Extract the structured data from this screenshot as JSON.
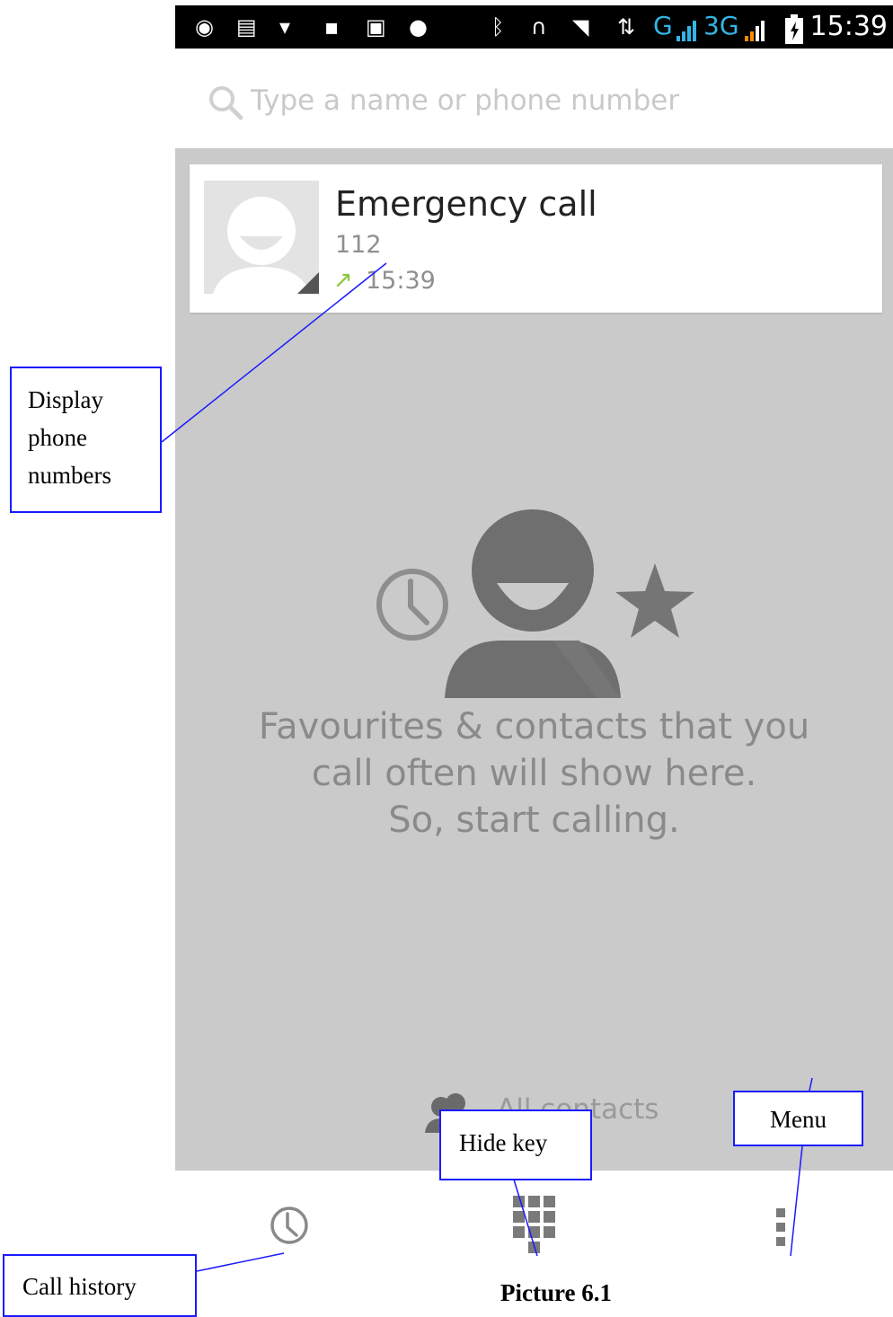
{
  "status_bar": {
    "time": "15:39",
    "network_labels": [
      "G",
      "3G"
    ],
    "icons": [
      "app-notification-icon",
      "message-icon",
      "wifi-notification-icon",
      "lock-icon",
      "image-icon",
      "hangouts-icon",
      "bluetooth-icon",
      "headphones-icon",
      "wifi-icon",
      "data-transfer-icon",
      "signal-icon",
      "signal-icon",
      "battery-icon"
    ],
    "accent_color": "#33b5e5"
  },
  "search": {
    "placeholder": "Type a name or phone number"
  },
  "recent_call": {
    "name": "Emergency call",
    "number": "112",
    "time": "15:39",
    "direction_glyph": "↗",
    "direction_color": "#8cc63f"
  },
  "empty_state": {
    "lines": [
      "Favourites & contacts that you",
      "call often will show here.",
      "So, start calling."
    ]
  },
  "all_contacts": {
    "label": "All contacts"
  },
  "bottom_nav": {
    "items": [
      "call-history-icon",
      "dialpad-icon",
      "overflow-menu-icon"
    ]
  },
  "annotations": {
    "display_numbers": [
      "Display",
      "phone",
      "numbers"
    ],
    "hide_key": "Hide key",
    "menu": "Menu",
    "call_history": "Call history",
    "caption": "Picture 6.1",
    "line_color": "#1a1aff"
  }
}
